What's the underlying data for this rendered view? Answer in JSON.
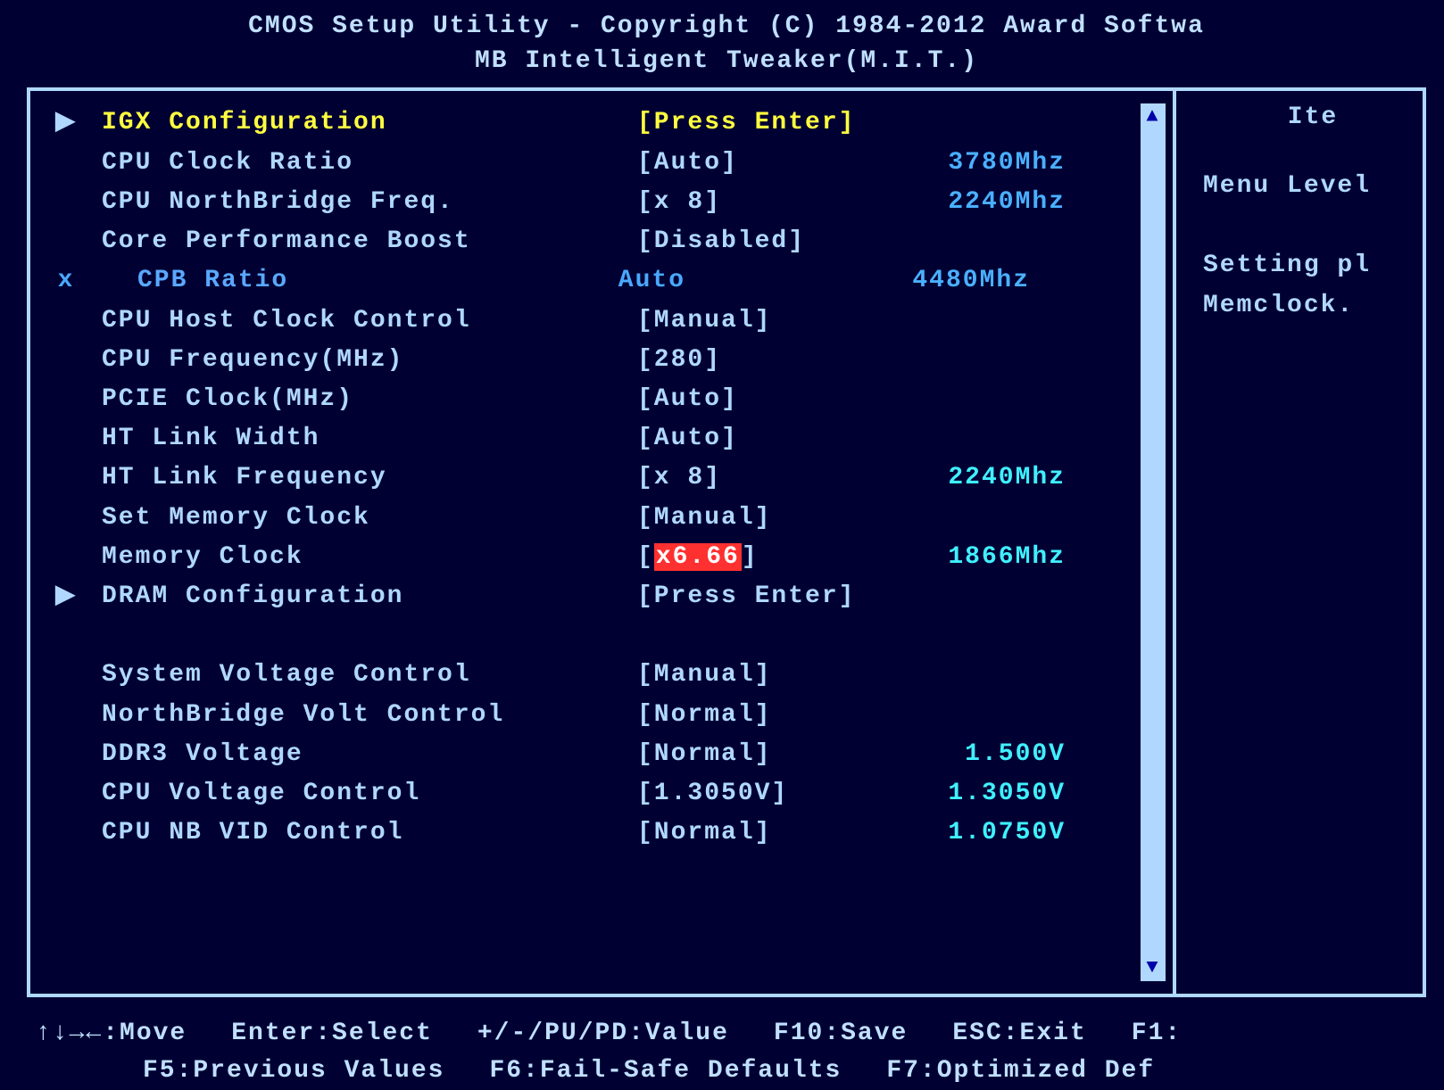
{
  "header": {
    "line1": "CMOS Setup Utility - Copyright (C) 1984-2012 Award Softwa",
    "line2": "MB Intelligent Tweaker(M.I.T.)"
  },
  "items": [
    {
      "marker": "▶",
      "label": "IGX Configuration",
      "value": "[Press Enter]",
      "readout": "",
      "selected": true
    },
    {
      "marker": "",
      "label": "CPU Clock Ratio",
      "value": "[Auto]",
      "readout": "3780Mhz"
    },
    {
      "marker": "",
      "label": "CPU NorthBridge Freq.",
      "value": "[x 8]",
      "readout": "2240Mhz"
    },
    {
      "marker": "",
      "label": "Core Performance Boost",
      "value": "[Disabled]",
      "readout": ""
    },
    {
      "marker": "x",
      "label": "CPB Ratio",
      "value": " Auto",
      "readout": "4480Mhz",
      "dim": true
    },
    {
      "marker": "",
      "label": "CPU Host Clock Control",
      "value": "[Manual]",
      "readout": ""
    },
    {
      "marker": "",
      "label": "CPU Frequency(MHz)",
      "value": "[280]",
      "readout": ""
    },
    {
      "marker": "",
      "label": "PCIE Clock(MHz)",
      "value": "[Auto]",
      "readout": ""
    },
    {
      "marker": "",
      "label": "HT Link Width",
      "value": "[Auto]",
      "readout": ""
    },
    {
      "marker": "",
      "label": "HT Link Frequency",
      "value": "[x 8]",
      "readout": "2240Mhz",
      "readoutCyan": true
    },
    {
      "marker": "",
      "label": "Set Memory Clock",
      "value": "[Manual]",
      "readout": ""
    },
    {
      "marker": "",
      "label": "Memory Clock",
      "value_prefix": "[",
      "value_hl": "x6.66",
      "value_suffix": "]",
      "readout": "1866Mhz",
      "readoutCyan": true,
      "highlight": true
    },
    {
      "marker": "▶",
      "label": "DRAM Configuration",
      "value": "[Press Enter]",
      "readout": ""
    },
    {
      "spacer": true
    },
    {
      "marker": "",
      "label": "System Voltage Control",
      "value": "[Manual]",
      "readout": ""
    },
    {
      "marker": "",
      "label": "NorthBridge Volt Control",
      "value": "[Normal]",
      "readout": ""
    },
    {
      "marker": "",
      "label": "DDR3 Voltage",
      "value": "[Normal]",
      "readout": "1.500V",
      "readoutCyan": true
    },
    {
      "marker": "",
      "label": "CPU Voltage Control",
      "value": "[1.3050V]",
      "readout": "1.3050V",
      "readoutCyan": true
    },
    {
      "marker": "",
      "label": "CPU NB VID Control",
      "value": "[Normal]",
      "readout": "1.0750V",
      "readoutCyan": true
    }
  ],
  "side": {
    "title": "Ite",
    "line1": "Menu Level",
    "line2": "Setting pl",
    "line3": "Memclock."
  },
  "footer": {
    "r1c1": "↑↓→←:Move",
    "r1c2": "Enter:Select",
    "r1c3": "+/-/PU/PD:Value",
    "r1c4": "F10:Save",
    "r1c5": "ESC:Exit",
    "r1c6": "F1:",
    "r2c1": "F5:Previous Values",
    "r2c2": "F6:Fail-Safe Defaults",
    "r2c3": "F7:Optimized Def"
  }
}
